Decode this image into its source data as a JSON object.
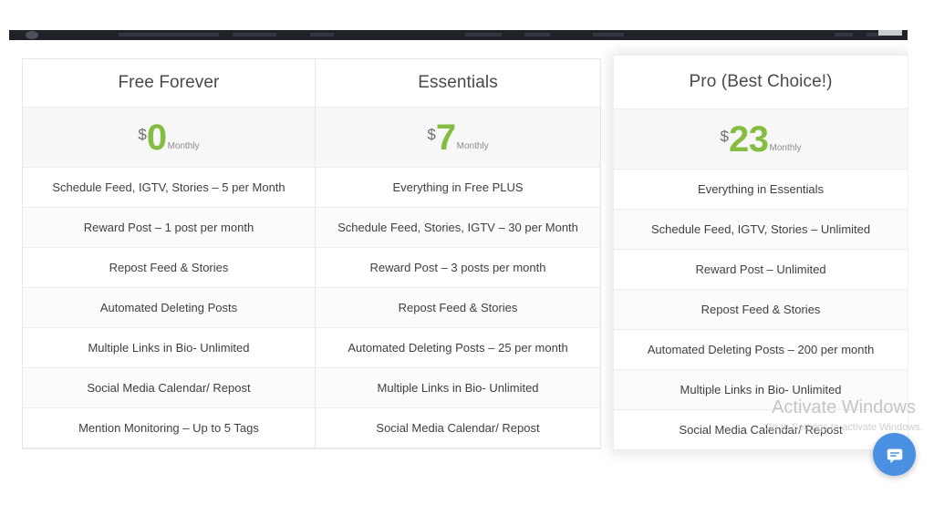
{
  "window_chrome": {
    "present": true,
    "bar_color": "#1f2229"
  },
  "pricing_table": {
    "currency_symbol": "$",
    "period_label": "Monthly",
    "accent_color": "#84bd41",
    "plans": [
      {
        "name": "Free Forever",
        "price": "0",
        "currency": "$",
        "period": "Monthly",
        "highlighted": false,
        "features": [
          "Schedule Feed, IGTV, Stories – 5 per Month",
          "Reward Post – 1 post per month",
          "Repost Feed & Stories",
          "Automated Deleting Posts",
          "Multiple Links in Bio- Unlimited",
          "Social Media Calendar/ Repost",
          "Mention Monitoring – Up to 5 Tags"
        ]
      },
      {
        "name": "Essentials",
        "price": "7",
        "currency": "$",
        "period": "Monthly",
        "highlighted": false,
        "features": [
          "Everything in Free PLUS",
          "Schedule Feed, Stories, IGTV – 30 per Month",
          "Reward Post – 3 posts per month",
          "Repost Feed & Stories",
          "Automated Deleting Posts – 25 per month",
          "Multiple Links in Bio- Unlimited",
          "Social Media Calendar/ Repost"
        ]
      },
      {
        "name": "Pro (Best Choice!)",
        "price": "23",
        "currency": "$",
        "period": "Monthly",
        "highlighted": true,
        "features": [
          "Everything in Essentials",
          "Schedule Feed, IGTV, Stories – Unlimited",
          "Reward Post – Unlimited",
          "Repost Feed & Stories",
          "Automated Deleting Posts – 200 per month",
          "Multiple Links in Bio- Unlimited",
          "Social Media Calendar/ Repost"
        ]
      }
    ]
  },
  "windows_watermark": {
    "title": "Activate Windows",
    "subtitle": "Go to Settings to activate Windows."
  },
  "chat_widget": {
    "icon": "chat-bubble-icon",
    "color": "#4a90e2",
    "label": "Open chat"
  }
}
